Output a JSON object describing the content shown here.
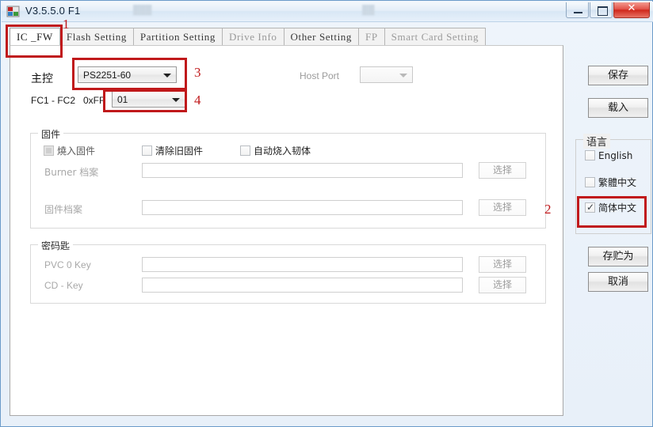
{
  "window": {
    "title": "V3.5.5.0 F1",
    "icon": "app-icon",
    "minimize_label": "Minimize",
    "maximize_label": "Maximize",
    "close_label": "✕"
  },
  "tabs": [
    {
      "label": "IC _FW",
      "active": true
    },
    {
      "label": "Flash Setting",
      "active": false
    },
    {
      "label": "Partition Setting",
      "active": false
    },
    {
      "label": "Drive Info",
      "active": false
    },
    {
      "label": "Other Setting",
      "active": false
    },
    {
      "label": "FP",
      "active": false
    },
    {
      "label": "Smart Card Setting",
      "active": false
    }
  ],
  "main": {
    "controller_label": "主控",
    "controller_value": "PS2251-60",
    "host_port_label": "Host Port",
    "host_port_value": "",
    "fc_label": "FC1 - FC2",
    "fc_hex": "0xFF",
    "fc_value": "01",
    "firmware_group": {
      "caption": "固件",
      "checkboxes": [
        {
          "label": "燒入固件",
          "checked": false,
          "disabled": true
        },
        {
          "label": "清除旧固件",
          "checked": false,
          "disabled": false
        },
        {
          "label": "自动烧入韧体",
          "checked": false,
          "disabled": false
        }
      ],
      "rows": [
        {
          "label": "Burner 档案",
          "value": "",
          "button": "选择"
        },
        {
          "label": "固件档案",
          "value": "",
          "button": "选择"
        }
      ]
    },
    "key_group": {
      "caption": "密码匙",
      "rows": [
        {
          "label": "PVC 0 Key",
          "value": "",
          "button": "选择"
        },
        {
          "label": "CD - Key",
          "value": "",
          "button": "选择"
        }
      ]
    }
  },
  "right_panel": {
    "save_button": "保存",
    "load_button": "载入",
    "language_group": {
      "caption": "语言",
      "options": [
        {
          "label": "English",
          "checked": false
        },
        {
          "label": "繁體中文",
          "checked": false
        },
        {
          "label": "简体中文",
          "checked": true
        }
      ]
    },
    "save_as_button": "存贮为",
    "cancel_button": "取消"
  },
  "annotations": {
    "color": "#c0191b",
    "markers": [
      {
        "id": "1",
        "target": "tab-ic-fw"
      },
      {
        "id": "2",
        "target": "simplified-chinese-checkbox"
      },
      {
        "id": "3",
        "target": "controller-combo"
      },
      {
        "id": "4",
        "target": "fc-combo"
      }
    ]
  }
}
